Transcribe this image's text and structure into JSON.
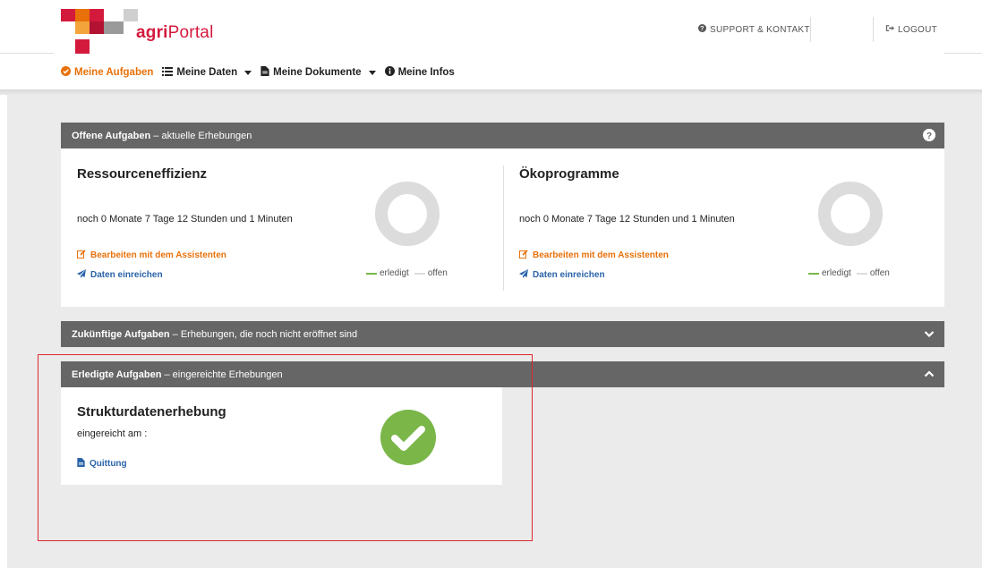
{
  "brand": {
    "name_bold": "agri",
    "name_regular": "Portal",
    "colors": {
      "red": "#d41a3c",
      "orange": "#e8710a",
      "gray": "#9a9a9a",
      "light_gray": "#cccccc",
      "dark_red": "#b31232"
    }
  },
  "header": {
    "support_label": "SUPPORT & KONTAKT",
    "support_icon": "question-circle-icon",
    "logout_label": "LOGOUT",
    "logout_icon": "sign-out-icon"
  },
  "nav": {
    "items": [
      {
        "label": "Meine Aufgaben",
        "icon": "check-circle-icon",
        "active": true,
        "dropdown": false
      },
      {
        "label": "Meine Daten",
        "icon": "list-icon",
        "active": false,
        "dropdown": true
      },
      {
        "label": "Meine Dokumente",
        "icon": "document-icon",
        "active": false,
        "dropdown": true
      },
      {
        "label": "Meine Infos",
        "icon": "info-circle-icon",
        "active": false,
        "dropdown": false
      }
    ]
  },
  "panels": {
    "open": {
      "title_bold": "Offene Aufgaben",
      "title_rest": " – aktuelle Erhebungen",
      "control_icon": "help-icon",
      "tasks": [
        {
          "title": "Ressourceneffizienz",
          "remaining": "noch 0 Monate 7 Tage 12 Stunden und 1 Minuten",
          "edit_label": "Bearbeiten mit dem Assistenten",
          "submit_label": "Daten einreichen",
          "legend_done": "erledigt",
          "legend_open": "offen",
          "progress_done": 0
        },
        {
          "title": "Ökoprogramme",
          "remaining": "noch 0 Monate 7 Tage 12 Stunden und 1 Minuten",
          "edit_label": "Bearbeiten mit dem Assistenten",
          "submit_label": "Daten einreichen",
          "legend_done": "erledigt",
          "legend_open": "offen",
          "progress_done": 0
        }
      ]
    },
    "future": {
      "title_bold": "Zukünftige Aufgaben",
      "title_rest": " – Erhebungen, die noch nicht eröffnet sind",
      "control_icon": "chevron-down-icon"
    },
    "done": {
      "title_bold": "Erledigte Aufgaben",
      "title_rest": " – eingereichte Erhebungen",
      "control_icon": "chevron-up-icon",
      "task": {
        "title": "Strukturdatenerhebung",
        "submitted": "eingereicht am :",
        "receipt_label": "Quittung",
        "status_icon": "check-circle-icon",
        "status_color": "#7ab648"
      }
    }
  }
}
